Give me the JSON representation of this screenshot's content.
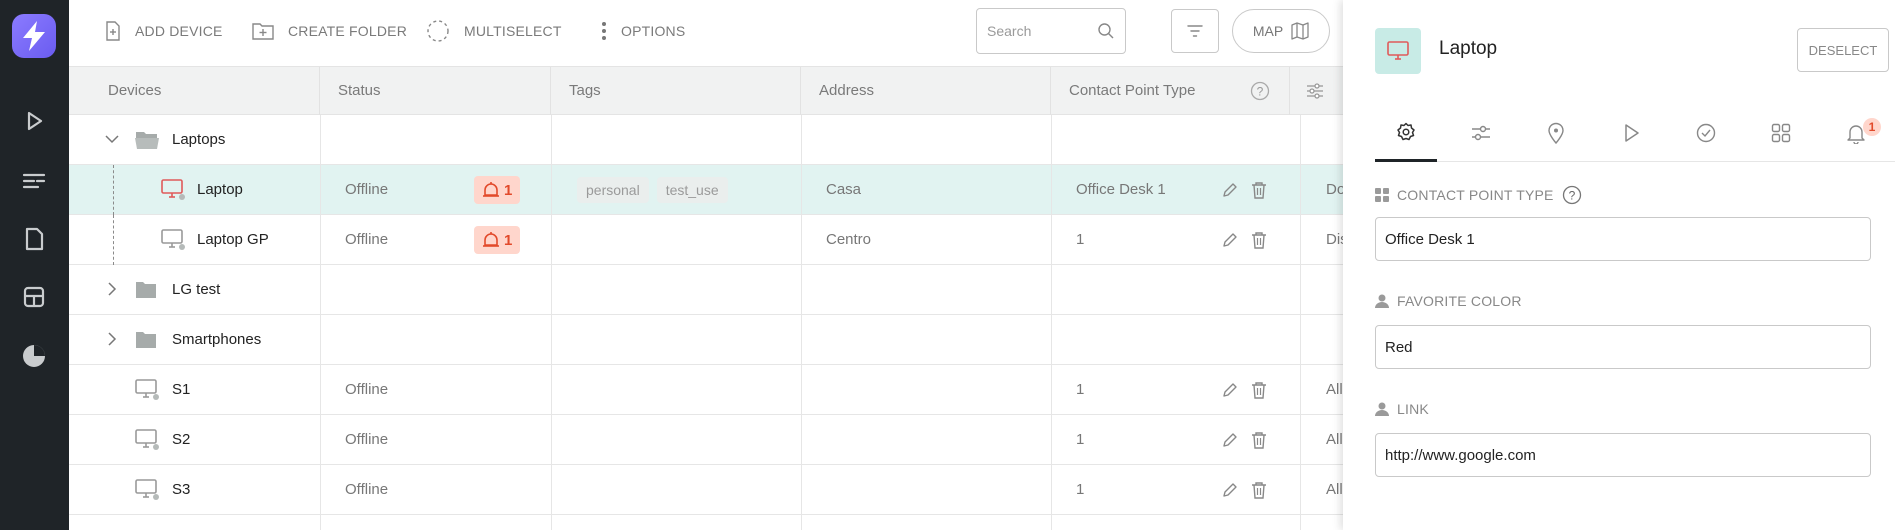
{
  "colors": {
    "rail_bg": "#1f2428",
    "logo": "#7b6cf6",
    "selected_row": "#e1f3f1",
    "alert_badge_bg": "#ffd6cc",
    "alert_badge_text": "#e24a2b",
    "device_icon_bg": "#c8ebe6",
    "device_icon_alert": "#e05a5a"
  },
  "sidebar": {
    "items": [
      {
        "name": "play-icon"
      },
      {
        "name": "list-icon"
      },
      {
        "name": "document-icon"
      },
      {
        "name": "layout-icon"
      },
      {
        "name": "pie-chart-icon"
      }
    ]
  },
  "toolbar": {
    "add_device": "ADD DEVICE",
    "create_folder": "CREATE FOLDER",
    "multiselect": "MULTISELECT",
    "options": "OPTIONS",
    "search_placeholder": "Search",
    "map": "MAP"
  },
  "table": {
    "columns": [
      "Devices",
      "Status",
      "Tags",
      "Address",
      "Contact Point Type"
    ],
    "rows": [
      {
        "type": "folder",
        "name": "Laptops",
        "expanded": true
      },
      {
        "type": "device",
        "name": "Laptop",
        "status": "Offline",
        "alerts": "1",
        "tags": [
          "personal",
          "test_use"
        ],
        "address": "Casa",
        "contact_point_type": "Office Desk 1",
        "extra": "Do",
        "selected": true
      },
      {
        "type": "device",
        "name": "Laptop GP",
        "status": "Offline",
        "alerts": "1",
        "tags": [],
        "address": "Centro",
        "contact_point_type": "1",
        "extra": "Dis"
      },
      {
        "type": "folder",
        "name": "LG test",
        "expanded": false
      },
      {
        "type": "folder",
        "name": "Smartphones",
        "expanded": false
      },
      {
        "type": "device",
        "name": "S1",
        "status": "Offline",
        "contact_point_type": "1",
        "extra": "All"
      },
      {
        "type": "device",
        "name": "S2",
        "status": "Offline",
        "contact_point_type": "1",
        "extra": "All"
      },
      {
        "type": "device",
        "name": "S3",
        "status": "Offline",
        "contact_point_type": "1",
        "extra": "All"
      }
    ]
  },
  "panel": {
    "title": "Laptop",
    "deselect": "DESELECT",
    "tabs": [
      "settings-icon",
      "sliders-icon",
      "location-icon",
      "play-icon",
      "check-circle-icon",
      "grid-icon",
      "bell-icon"
    ],
    "notification_count": "1",
    "fields": [
      {
        "label": "CONTACT POINT TYPE",
        "value": "Office Desk 1",
        "icon": "grid-icon",
        "help": true
      },
      {
        "label": "FAVORITE COLOR",
        "value": "Red",
        "icon": "person-icon"
      },
      {
        "label": "LINK",
        "value": "http://www.google.com",
        "icon": "person-icon"
      }
    ]
  }
}
